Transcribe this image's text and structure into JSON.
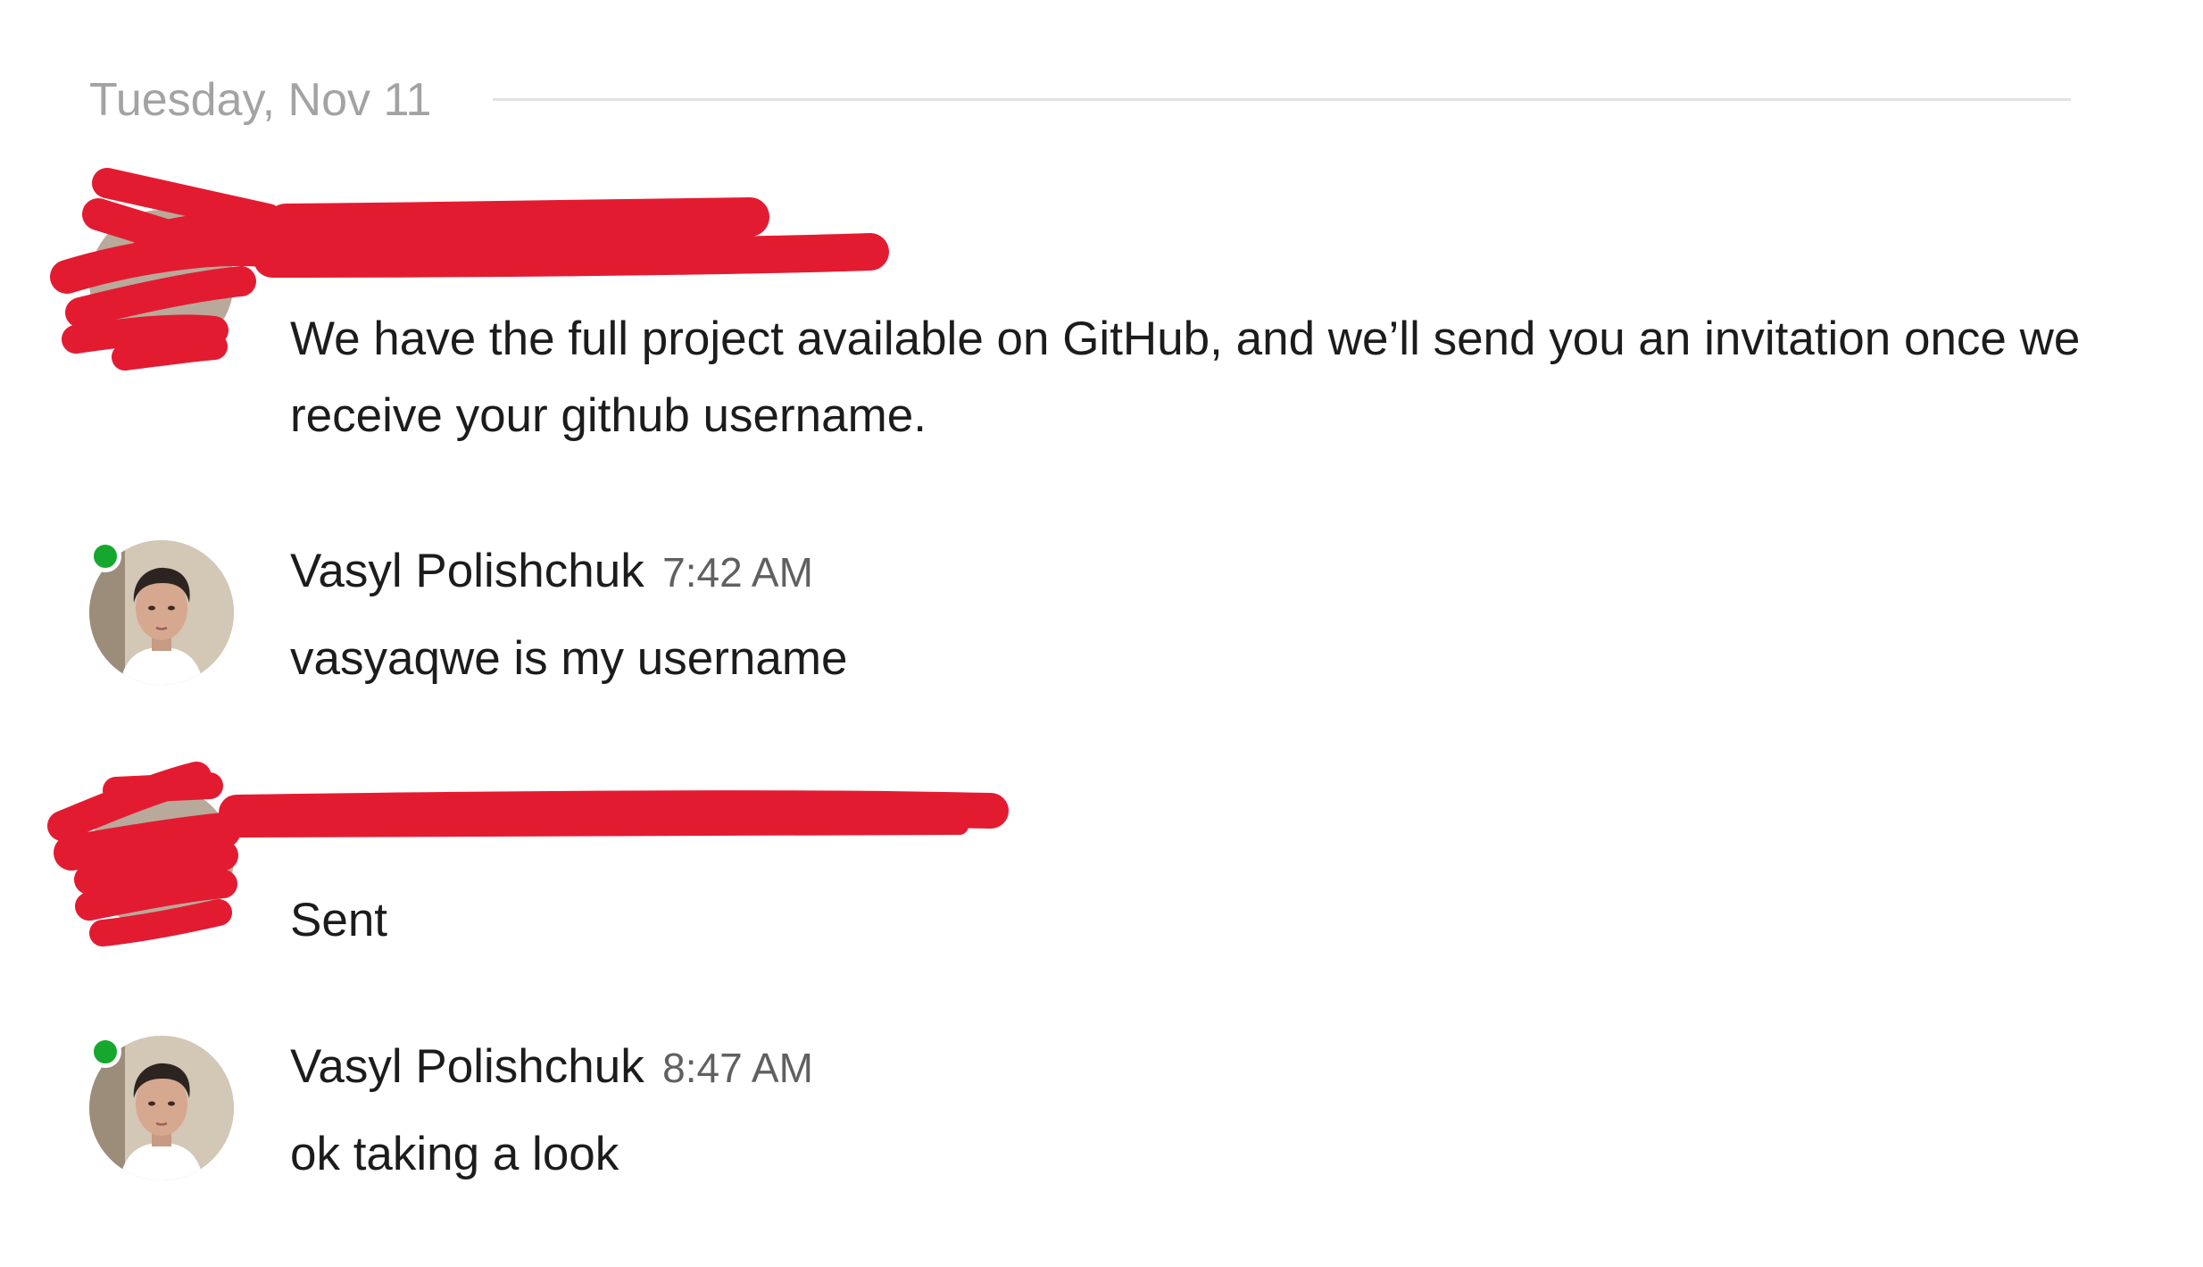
{
  "date_divider": {
    "label": "Tuesday, Nov 11"
  },
  "colors": {
    "presence": "#16a82e",
    "redaction": "#e31b31",
    "timestamp": "#616061",
    "divider_text": "#a3a3a3"
  },
  "messages": [
    {
      "sender": "",
      "time": "",
      "text": "We have the full project available on GitHub, and we’ll send you an invitation once we receive your github username.",
      "redacted": true
    },
    {
      "sender": "Vasyl Polishchuk",
      "time": "7:42 AM",
      "text": "vasyaqwe is my username",
      "online": true,
      "avatar": "user-photo-avatar"
    },
    {
      "sender": "",
      "time": "",
      "text": "Sent",
      "redacted": true
    },
    {
      "sender": "Vasyl Polishchuk",
      "time": "8:47 AM",
      "text": "ok taking a look",
      "online": true,
      "avatar": "user-photo-avatar"
    }
  ]
}
